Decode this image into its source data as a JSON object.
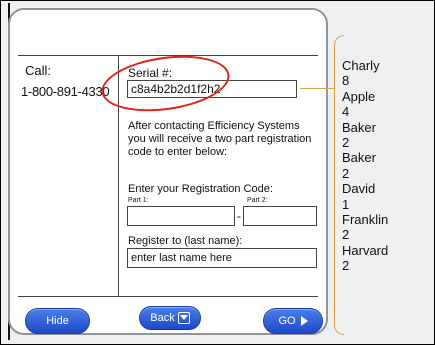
{
  "contact": {
    "call_label": "Call:",
    "phone": "1-800-891-4330"
  },
  "serial": {
    "label": "Serial #:",
    "value": "c8a4b2b2d1f2h2"
  },
  "info_text": "After contacting Efficiency Systems you will receive a two part registration code to enter below:",
  "registration": {
    "label": "Enter your Registration Code:",
    "part1_label": "Part 1:",
    "part2_label": "Part 2:",
    "part1_value": "",
    "part2_value": "",
    "separator": "-"
  },
  "register_to": {
    "label": "Register to (last name):",
    "value": "enter last name here"
  },
  "buttons": {
    "hide": "Hide",
    "back": "Back",
    "go": "GO"
  },
  "phonetic_decode": [
    "Charly",
    "8",
    "Apple",
    "4",
    "Baker",
    "2",
    "Baker",
    "2",
    "David",
    "1",
    "Franklin",
    "2",
    "Harvard",
    "2"
  ],
  "colors": {
    "button_blue": "#2553d8",
    "highlight_red": "#e0201a",
    "bracket_gold": "#d4a24c",
    "panel_border": "#8f959a"
  },
  "icons": {
    "back": "down-arrow-box-icon",
    "go": "play-triangle-icon"
  }
}
